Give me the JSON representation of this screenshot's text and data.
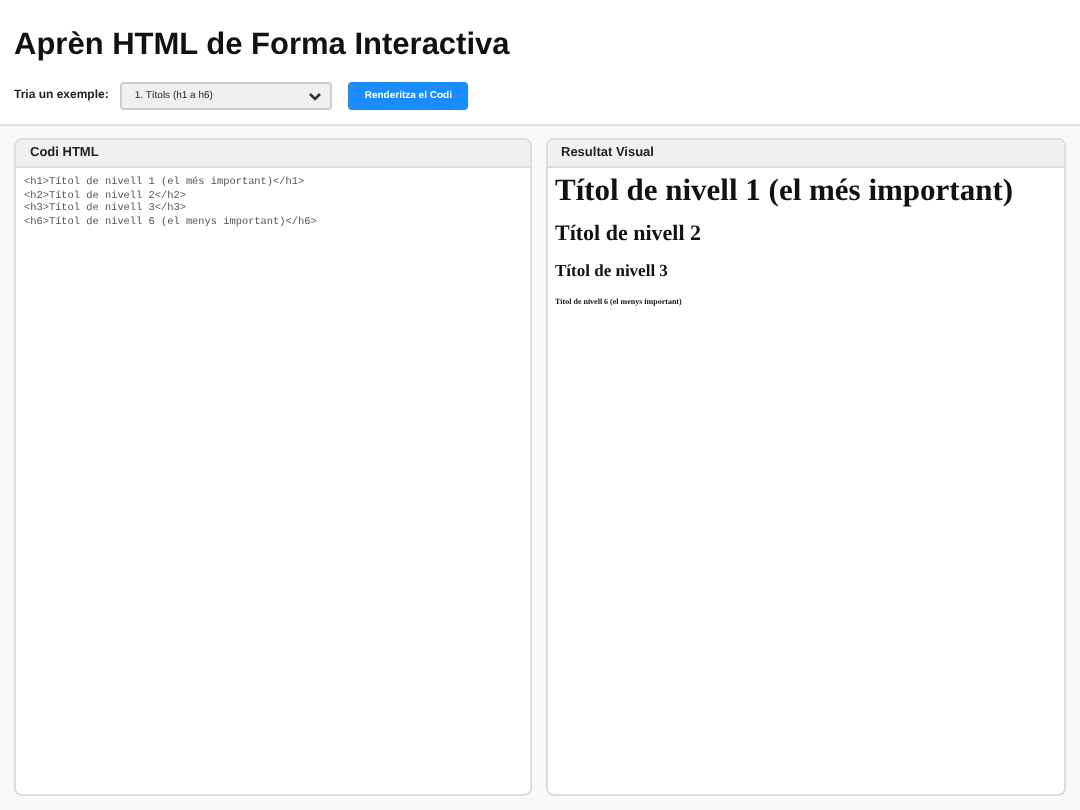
{
  "title": "Aprèn HTML de Forma Interactiva",
  "controls": {
    "label": "Tria un exemple:",
    "select_value": "1. Títols (h1 a h6)",
    "button": "Renderitza el Codi"
  },
  "code_panel": {
    "title": "Codi HTML",
    "lines": [
      "<h1>Títol de nivell 1 (el més important)</h1>",
      "<h2>Títol de nivell 2</h2>",
      "<h3>Títol de nivell 3</h3>",
      "<h6>Títol de nivell 6 (el menys important)</h6>"
    ]
  },
  "result_panel": {
    "title": "Resultat Visual",
    "headings": [
      {
        "kind": "h1",
        "text": "Títol de nivell 1 (el més important)"
      },
      {
        "kind": "h2",
        "text": "Títol de nivell 2"
      },
      {
        "kind": "h3",
        "text": "Títol de nivell 3"
      },
      {
        "kind": "h6",
        "text": "Títol de nivell 6 (el menys important)"
      }
    ]
  }
}
